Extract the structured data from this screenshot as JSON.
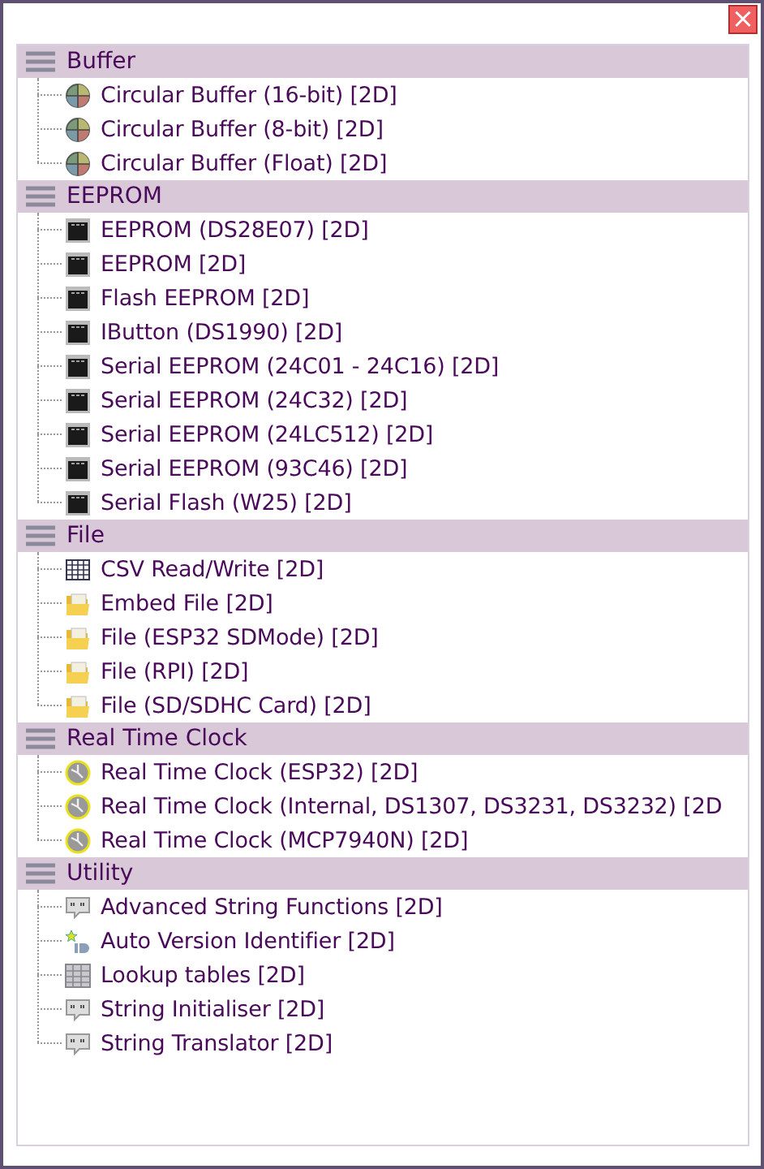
{
  "window": {
    "close_button": "×"
  },
  "groups": [
    {
      "title": "Buffer",
      "items": [
        {
          "label": "Circular Buffer (16-bit) [2D]",
          "kind": "pie"
        },
        {
          "label": "Circular Buffer (8-bit) [2D]",
          "kind": "pie"
        },
        {
          "label": "Circular Buffer (Float) [2D]",
          "kind": "pie"
        }
      ]
    },
    {
      "title": "EEPROM",
      "items": [
        {
          "label": "EEPROM (DS28E07) [2D]",
          "kind": "chip"
        },
        {
          "label": "EEPROM [2D]",
          "kind": "chip"
        },
        {
          "label": "Flash EEPROM [2D]",
          "kind": "chip"
        },
        {
          "label": "IButton (DS1990) [2D]",
          "kind": "chip"
        },
        {
          "label": "Serial EEPROM (24C01 - 24C16) [2D]",
          "kind": "chip"
        },
        {
          "label": "Serial EEPROM (24C32) [2D]",
          "kind": "chip"
        },
        {
          "label": "Serial EEPROM (24LC512) [2D]",
          "kind": "chip"
        },
        {
          "label": "Serial EEPROM (93C46) [2D]",
          "kind": "chip"
        },
        {
          "label": "Serial Flash (W25) [2D]",
          "kind": "chip"
        }
      ]
    },
    {
      "title": "File",
      "items": [
        {
          "label": "CSV Read/Write [2D]",
          "kind": "grid"
        },
        {
          "label": "Embed File [2D]",
          "kind": "folder"
        },
        {
          "label": "File (ESP32 SDMode) [2D]",
          "kind": "folder"
        },
        {
          "label": "File (RPI) [2D]",
          "kind": "folder"
        },
        {
          "label": "File (SD/SDHC Card) [2D]",
          "kind": "folder"
        }
      ]
    },
    {
      "title": "Real Time Clock",
      "items": [
        {
          "label": "Real Time Clock (ESP32) [2D]",
          "kind": "clock"
        },
        {
          "label": "Real Time Clock (Internal, DS1307, DS3231, DS3232) [2D",
          "kind": "clock"
        },
        {
          "label": "Real Time Clock (MCP7940N) [2D]",
          "kind": "clock"
        }
      ]
    },
    {
      "title": "Utility",
      "items": [
        {
          "label": "Advanced String Functions [2D]",
          "kind": "quote"
        },
        {
          "label": "Auto Version Identifier [2D]",
          "kind": "id"
        },
        {
          "label": "Lookup tables [2D]",
          "kind": "table"
        },
        {
          "label": "String Initialiser [2D]",
          "kind": "quote"
        },
        {
          "label": "String Translator [2D]",
          "kind": "quote"
        }
      ]
    }
  ]
}
